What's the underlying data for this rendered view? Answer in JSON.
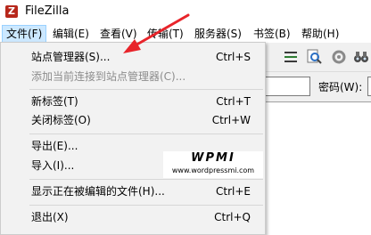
{
  "window": {
    "title": "FileZilla",
    "icon": "filezilla-icon"
  },
  "menubar": {
    "items": [
      {
        "label": "文件(F)",
        "active": true
      },
      {
        "label": "编辑(E)"
      },
      {
        "label": "查看(V)"
      },
      {
        "label": "传输(T)"
      },
      {
        "label": "服务器(S)"
      },
      {
        "label": "书签(B)"
      },
      {
        "label": "帮助(H)"
      }
    ]
  },
  "quickconnect": {
    "password_label": "密码(W):"
  },
  "file_menu": {
    "items": [
      {
        "label": "站点管理器(S)...",
        "shortcut": "Ctrl+S",
        "enabled": true
      },
      {
        "label": "添加当前连接到站点管理器(C)...",
        "shortcut": "",
        "enabled": false
      },
      {
        "label": "新标签(T)",
        "shortcut": "Ctrl+T",
        "enabled": true
      },
      {
        "label": "关闭标签(O)",
        "shortcut": "Ctrl+W",
        "enabled": true
      },
      {
        "label": "导出(E)...",
        "shortcut": "",
        "enabled": true
      },
      {
        "label": "导入(I)...",
        "shortcut": "",
        "enabled": true
      },
      {
        "label": "显示正在被编辑的文件(H)...",
        "shortcut": "Ctrl+E",
        "enabled": true
      },
      {
        "label": "退出(X)",
        "shortcut": "Ctrl+Q",
        "enabled": true
      }
    ]
  },
  "watermark": {
    "title": "WPMI",
    "url": "www.wordpressmi.com"
  },
  "colors": {
    "menu_highlight": "#cce8ff",
    "arrow": "#e8242a",
    "disabled_text": "#8c8c8c"
  }
}
